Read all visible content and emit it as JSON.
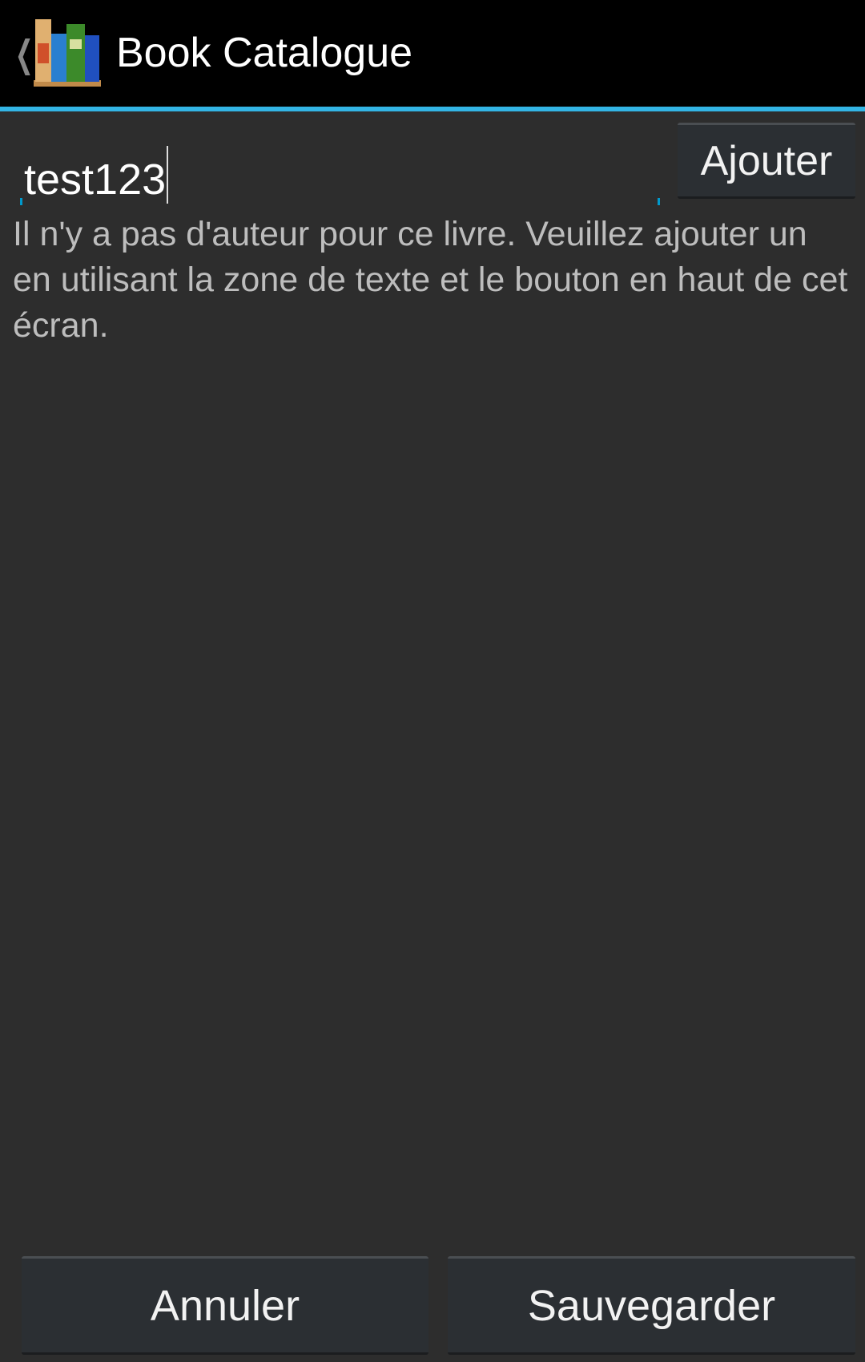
{
  "action_bar": {
    "title": "Book Catalogue",
    "up_icon": "chevron-left-icon",
    "logo_icon": "books-icon",
    "accent_color": "#33b5e5"
  },
  "author_input": {
    "value": "test123"
  },
  "add_button": {
    "label": "Ajouter"
  },
  "message": "Il n'y a pas d'auteur pour ce livre. Veuillez ajouter un en utilisant la zone de texte et le bouton en haut de cet écran.",
  "footer": {
    "cancel_label": "Annuler",
    "save_label": "Sauvegarder"
  }
}
